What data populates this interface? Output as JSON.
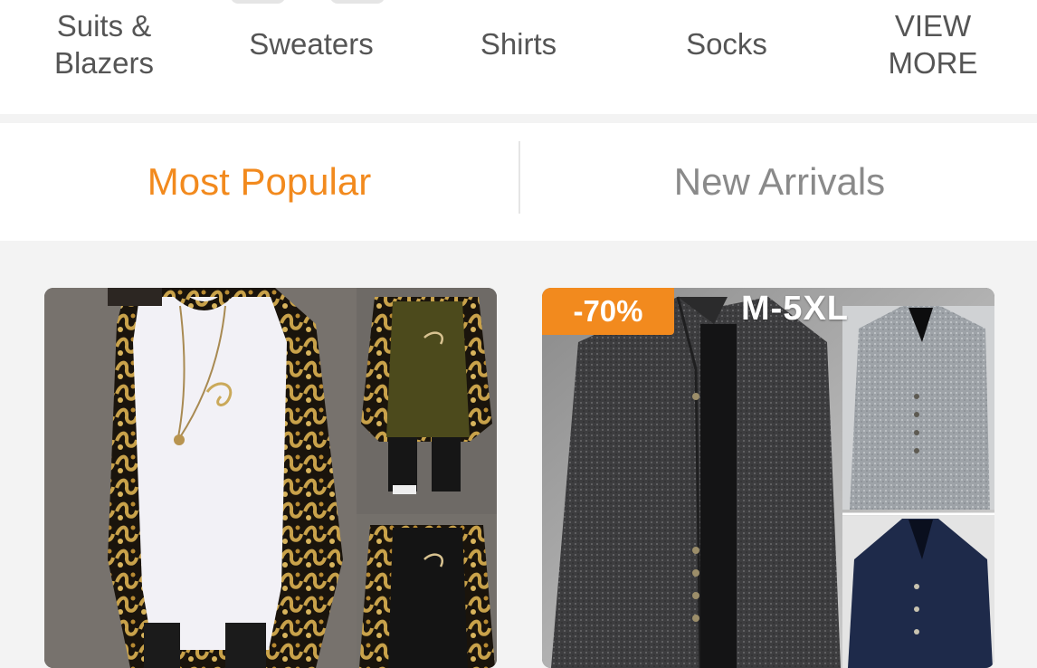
{
  "categories": [
    {
      "line1": "Suits &",
      "line2": "Blazers"
    },
    {
      "line1": "Sweaters",
      "line2": ""
    },
    {
      "line1": "Shirts",
      "line2": ""
    },
    {
      "line1": "Socks",
      "line2": ""
    },
    {
      "line1": "VIEW",
      "line2": "MORE"
    }
  ],
  "tabs": {
    "popular": "Most Popular",
    "new": "New Arrivals"
  },
  "products": [
    {
      "badge": "",
      "size_label": ""
    },
    {
      "badge": "-70%",
      "size_label": "M-5XL"
    }
  ],
  "colors": {
    "accent": "#f28a1e",
    "text_gray": "#555555",
    "inactive_tab": "#8a8a8a",
    "background": "#f3f3f3"
  },
  "icons": [
    "tshirt-product-image",
    "jacket-product-image"
  ]
}
